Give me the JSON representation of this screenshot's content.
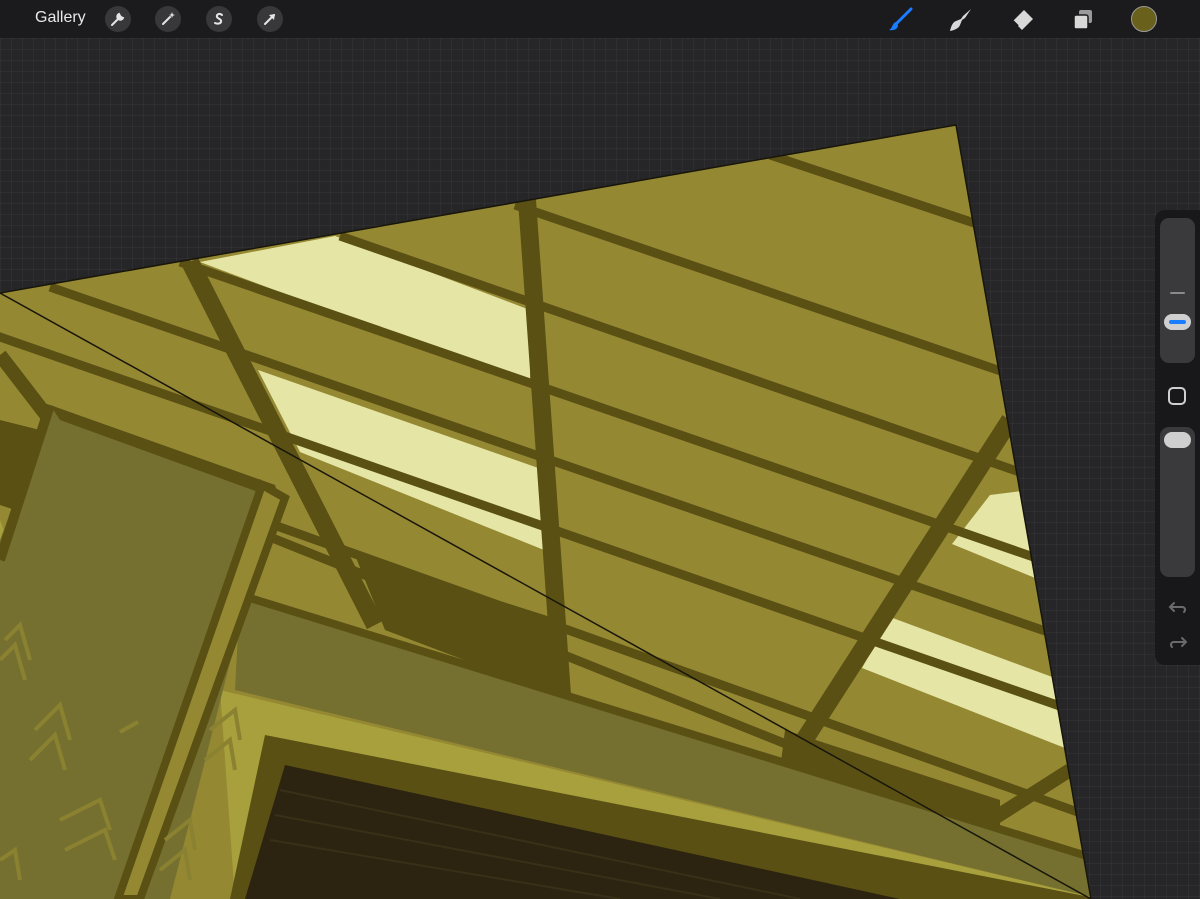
{
  "toolbar": {
    "gallery_label": "Gallery",
    "left_tools": [
      {
        "name": "actions",
        "icon": "wrench-icon"
      },
      {
        "name": "adjustments",
        "icon": "magic-wand-icon"
      },
      {
        "name": "selection",
        "icon": "selection-s-icon"
      },
      {
        "name": "transform",
        "icon": "transform-arrow-icon"
      }
    ],
    "right_tools": [
      {
        "name": "brush",
        "icon": "brush-icon",
        "active": true
      },
      {
        "name": "smudge",
        "icon": "smudge-icon",
        "active": false
      },
      {
        "name": "eraser",
        "icon": "eraser-icon",
        "active": false
      },
      {
        "name": "layers",
        "icon": "layers-icon",
        "active": false
      }
    ],
    "current_color": "#69601c",
    "active_accent": "#1a7cff"
  },
  "sidebar": {
    "brush_size_level": 0.15,
    "opacity_level": 0.0,
    "modifier_button": "square-modifier-icon",
    "undo_icon": "undo-icon",
    "redo_icon": "redo-icon"
  },
  "artwork": {
    "palette": {
      "dark_line": "#5a5014",
      "mid": "#958833",
      "pale": "#e5e6a6",
      "beam": "#757030",
      "wall": "#a7a03c",
      "deep": "#2c2410"
    }
  }
}
